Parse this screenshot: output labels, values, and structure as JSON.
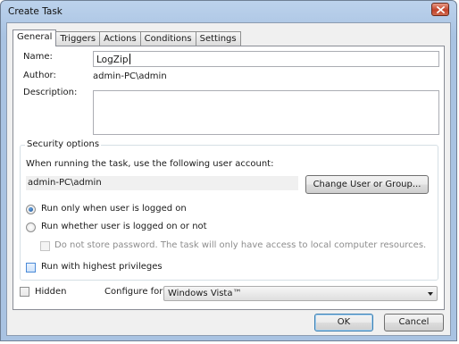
{
  "window": {
    "title": "Create Task"
  },
  "tabs": [
    {
      "label": "General"
    },
    {
      "label": "Triggers"
    },
    {
      "label": "Actions"
    },
    {
      "label": "Conditions"
    },
    {
      "label": "Settings"
    }
  ],
  "general": {
    "name_label": "Name:",
    "name_value": "LogZip",
    "author_label": "Author:",
    "author_value": "admin-PC\\admin",
    "description_label": "Description:",
    "description_value": ""
  },
  "security": {
    "group_title": "Security options",
    "account_prompt": "When running the task, use the following user account:",
    "account_value": "admin-PC\\admin",
    "change_button": "Change User or Group...",
    "radio_logged_on": "Run only when user is logged on",
    "radio_logged_on_selected": true,
    "radio_whether": "Run whether user is logged on or not",
    "no_store_password": "Do not store password.  The task will only have access to local computer resources.",
    "highest_privileges": "Run with highest privileges"
  },
  "footer": {
    "hidden_label": "Hidden",
    "configure_label": "Configure for:",
    "configure_value": "Windows Vista™",
    "ok_button": "OK",
    "cancel_button": "Cancel"
  },
  "icons": {
    "close": "close-icon"
  }
}
